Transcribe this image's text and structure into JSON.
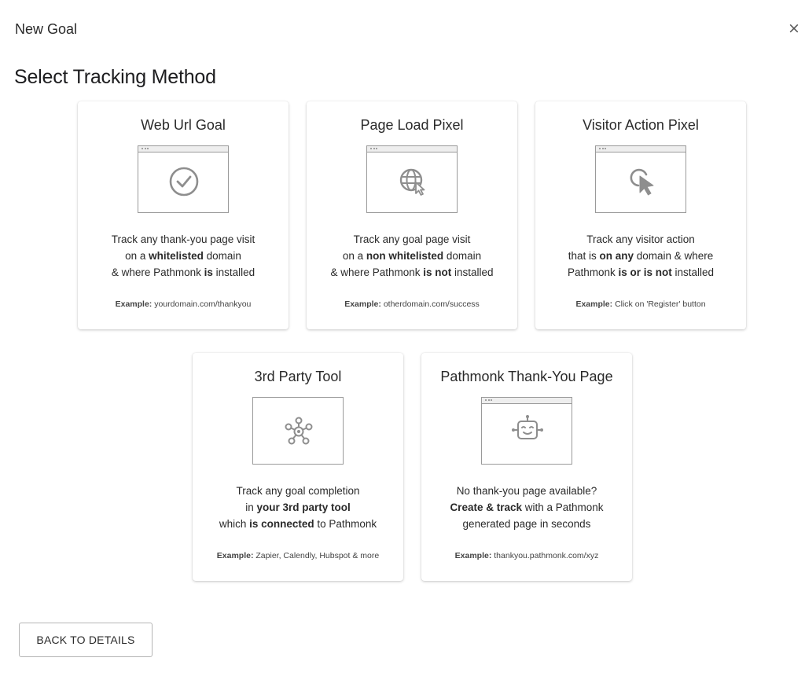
{
  "dialog": {
    "title": "New Goal",
    "close_label": "×",
    "section_title": "Select Tracking Method",
    "back_label": "BACK TO DETAILS"
  },
  "cards": [
    {
      "title": "Web Url Goal",
      "icon": "check-circle-icon",
      "desc": [
        {
          "t": "Track any thank-you page visit"
        },
        {
          "t": "on a "
        },
        {
          "b": "whitelisted"
        },
        {
          "t": " domain"
        },
        {
          "t": "& where Pathmonk "
        },
        {
          "b": "is"
        },
        {
          "t": " installed"
        }
      ],
      "desc_lines": [
        [
          {
            "t": "Track any thank-you page visit"
          }
        ],
        [
          {
            "t": "on a "
          },
          {
            "b": "whitelisted"
          },
          {
            "t": " domain"
          }
        ],
        [
          {
            "t": "& where Pathmonk "
          },
          {
            "b": "is"
          },
          {
            "t": " installed"
          }
        ]
      ],
      "example_label": "Example:",
      "example_value": "yourdomain.com/thankyou"
    },
    {
      "title": "Page Load Pixel",
      "icon": "globe-cursor-icon",
      "desc_lines": [
        [
          {
            "t": "Track any goal page visit"
          }
        ],
        [
          {
            "t": "on a "
          },
          {
            "b": "non whitelisted"
          },
          {
            "t": " domain"
          }
        ],
        [
          {
            "t": "& where Pathmonk "
          },
          {
            "b": "is not"
          },
          {
            "t": " installed"
          }
        ]
      ],
      "example_label": "Example:",
      "example_value": "otherdomain.com/success"
    },
    {
      "title": "Visitor Action Pixel",
      "icon": "click-cursor-icon",
      "desc_lines": [
        [
          {
            "t": "Track any visitor action"
          }
        ],
        [
          {
            "t": "that is "
          },
          {
            "b": "on any"
          },
          {
            "t": " domain & where"
          }
        ],
        [
          {
            "t": "Pathmonk "
          },
          {
            "b": "is or is not"
          },
          {
            "t": " installed"
          }
        ]
      ],
      "example_label": "Example:",
      "example_value": "Click on 'Register' button"
    },
    {
      "title": "3rd Party Tool",
      "icon": "integration-network-icon",
      "desc_lines": [
        [
          {
            "t": "Track any goal completion"
          }
        ],
        [
          {
            "t": "in "
          },
          {
            "b": "your 3rd party tool"
          }
        ],
        [
          {
            "t": "which "
          },
          {
            "b": "is connected"
          },
          {
            "t": " to Pathmonk"
          }
        ]
      ],
      "example_label": "Example:",
      "example_value": "Zapier, Calendly, Hubspot & more"
    },
    {
      "title": "Pathmonk Thank-You Page",
      "icon": "robot-face-icon",
      "desc_lines": [
        [
          {
            "t": "No thank-you page available?"
          }
        ],
        [
          {
            "b": "Create & track"
          },
          {
            "t": " with a Pathmonk"
          }
        ],
        [
          {
            "t": "generated page in seconds"
          }
        ]
      ],
      "example_label": "Example:",
      "example_value": "thankyou.pathmonk.com/xyz"
    }
  ]
}
